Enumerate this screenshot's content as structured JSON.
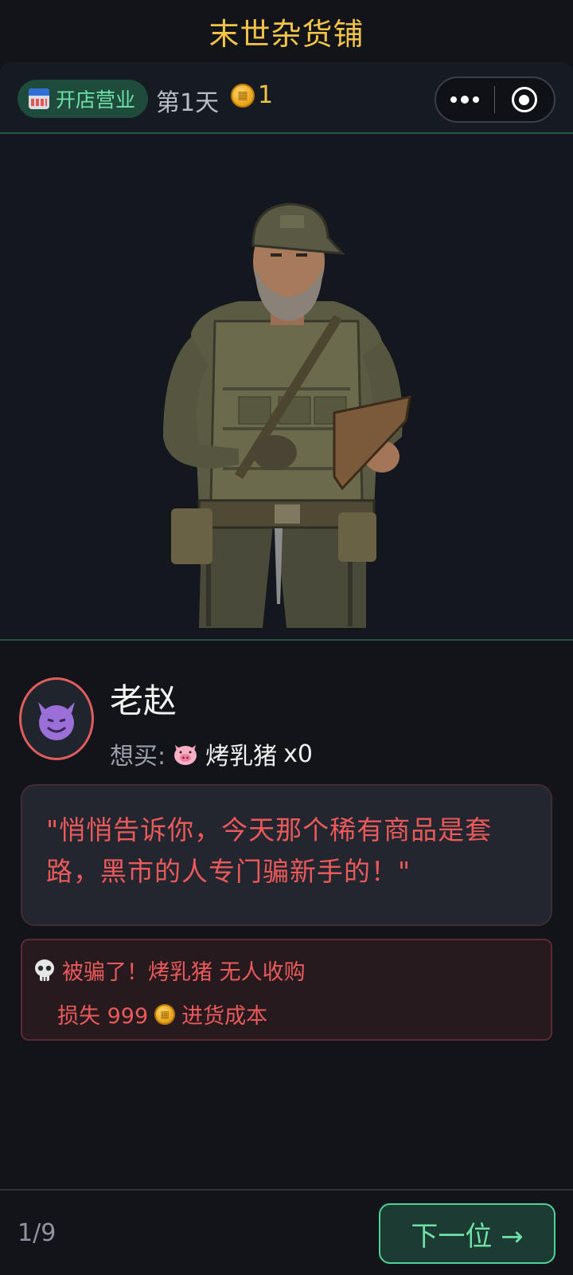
{
  "app": {
    "title": "末世杂货铺"
  },
  "status": {
    "shop_label": "开店营业",
    "day_label": "第1天",
    "coins": "1",
    "icons": [
      "store-24h-icon",
      "coin-icon",
      "more-icon",
      "target-icon"
    ]
  },
  "customer": {
    "name": "老赵",
    "avatar_icon": "smiling-devil-icon",
    "wants_label": "想买:",
    "item_icon": "pig-face-icon",
    "item_name": "烤乳猪",
    "quantity": "x0",
    "quote": "\"悄悄告诉你，今天那个稀有商品是套路，黑市的人专门骗新手的！\""
  },
  "alert": {
    "icon": "skull-icon",
    "line1": "被骗了！烤乳猪 无人收购",
    "loss_prefix": "损失 999",
    "loss_suffix": "进货成本"
  },
  "footer": {
    "page": "1/9",
    "next_label": "下一位 →"
  },
  "colors": {
    "accent_gold": "#f2c54a",
    "accent_green": "#6fe0a8",
    "danger_red": "#ea5a5a",
    "background": "#12141a"
  }
}
